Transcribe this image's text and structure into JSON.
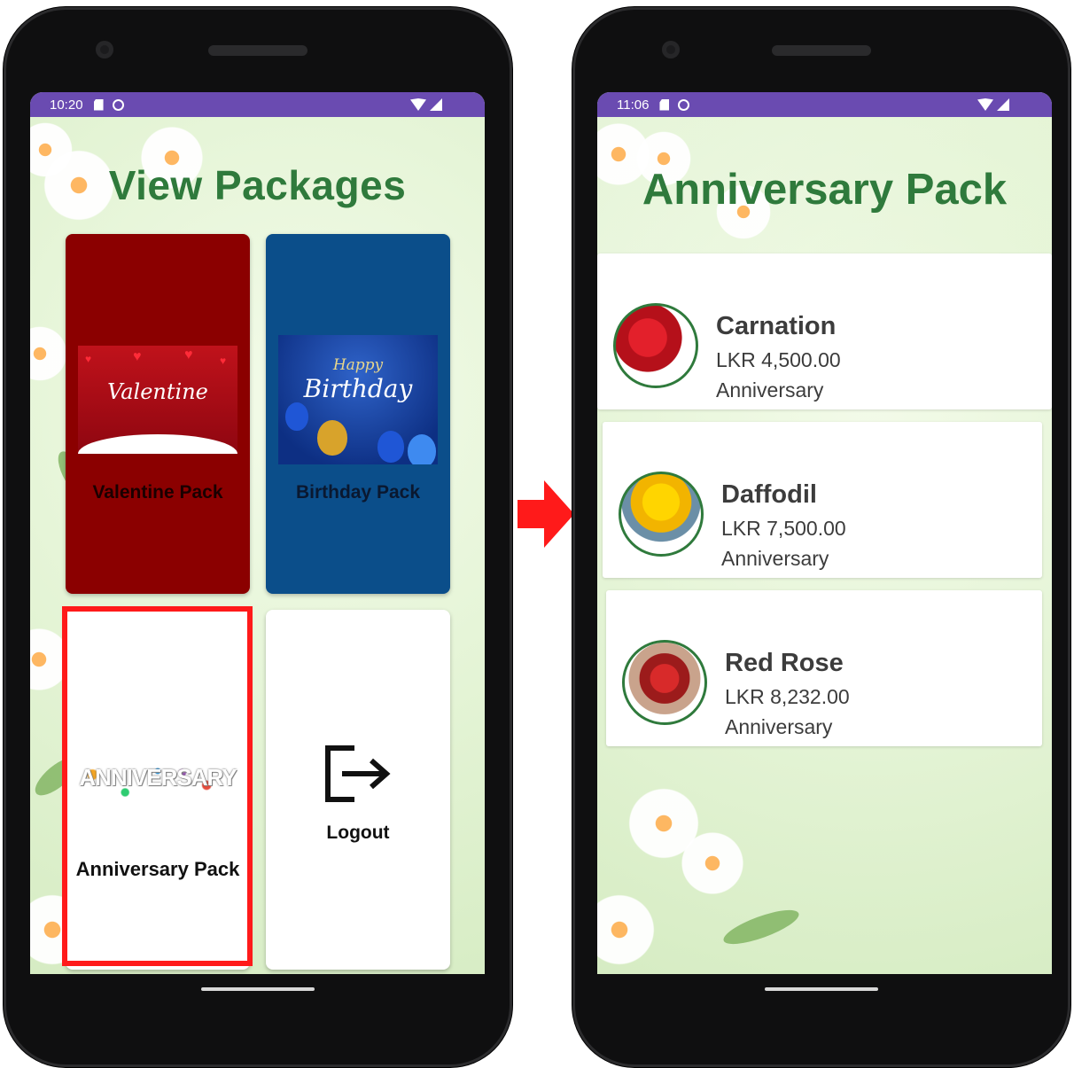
{
  "left_screen": {
    "status": {
      "time": "10:20"
    },
    "title": "View Packages",
    "cards": {
      "valentine": {
        "label": "Valentine Pack",
        "image_text": "Valentine"
      },
      "birthday": {
        "label": "Birthday Pack",
        "image_text_1": "Happy",
        "image_text_2": "Birthday"
      },
      "anniversary": {
        "label": "Anniversary Pack",
        "image_text": "ANNIVERSARY"
      },
      "logout": {
        "label": "Logout",
        "icon": "logout-icon"
      }
    },
    "highlight_color": "#ff1a1a"
  },
  "right_screen": {
    "status": {
      "time": "11:06"
    },
    "title": "Anniversary Pack",
    "items": [
      {
        "name": "Carnation",
        "price": "LKR 4,500.00",
        "category": "Anniversary"
      },
      {
        "name": "Daffodil",
        "price": "LKR 7,500.00",
        "category": "Anniversary"
      },
      {
        "name": "Red Rose",
        "price": "LKR 8,232.00",
        "category": "Anniversary"
      }
    ]
  },
  "colors": {
    "status_bar": "#6a4bb1",
    "title_green": "#2f7a3c",
    "valentine_card": "#8b0000",
    "birthday_card": "#0b4e8a",
    "arrow": "#ff1a1a"
  }
}
